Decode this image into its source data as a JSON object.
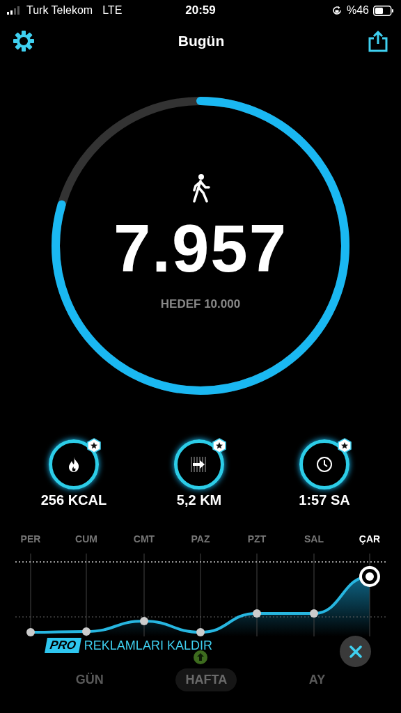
{
  "status_bar": {
    "carrier": "Turk Telekom",
    "network": "LTE",
    "time": "20:59",
    "battery": "%46"
  },
  "header": {
    "title": "Bugün"
  },
  "steps": {
    "count": "7.957",
    "goal": "HEDEF 10.000",
    "level": 0.7957
  },
  "metrics": [
    {
      "kind": "calories",
      "value": "256 KCAL"
    },
    {
      "kind": "distance",
      "value": "5,2 KM"
    },
    {
      "kind": "time",
      "value": "1:57 SA"
    }
  ],
  "days": [
    {
      "label": "PER",
      "selected": false
    },
    {
      "label": "CUM",
      "selected": false
    },
    {
      "label": "CMT",
      "selected": false
    },
    {
      "label": "PAZ",
      "selected": false
    },
    {
      "label": "PZT",
      "selected": false
    },
    {
      "label": "SAL",
      "selected": false
    },
    {
      "label": "ÇAR",
      "selected": true
    }
  ],
  "ad_banner": {
    "badge": "PRO",
    "text": "REKLAMLARI KALDIR"
  },
  "period_tabs": [
    {
      "label": "GÜN",
      "selected": false
    },
    {
      "label": "HAFTA",
      "selected": true
    },
    {
      "label": "AY",
      "selected": false
    }
  ]
}
